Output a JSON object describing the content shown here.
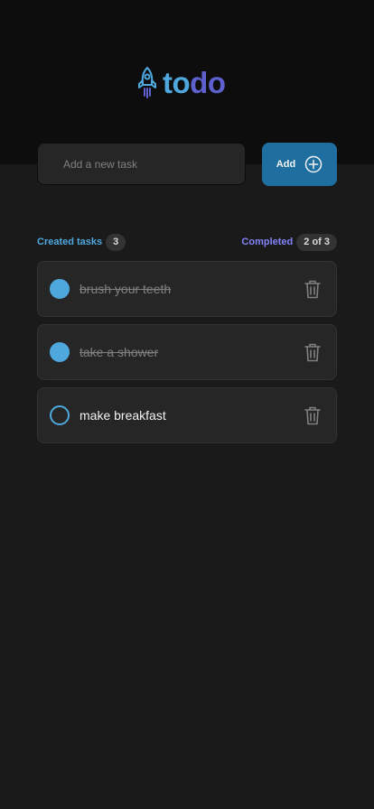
{
  "app": {
    "logo_icon": "rocket-icon",
    "logo_to": "to",
    "logo_do": "do"
  },
  "new_task": {
    "placeholder": "Add a new task",
    "value": "",
    "add_label": "Add",
    "add_icon": "plus-circle-icon"
  },
  "summary": {
    "created_label": "Created tasks",
    "created_count": "3",
    "completed_label": "Completed",
    "completed_count": "2 of 3"
  },
  "tasks": [
    {
      "label": "brush your teeth",
      "completed": true,
      "delete_icon": "trash-icon"
    },
    {
      "label": "take a shower",
      "completed": true,
      "delete_icon": "trash-icon"
    },
    {
      "label": "make breakfast",
      "completed": false,
      "delete_icon": "trash-icon"
    }
  ],
  "colors": {
    "header_bg": "#0d0d0d",
    "page_bg": "#1a1a1a",
    "blue": "#4ea8de",
    "blue_dark": "#1e6f9f",
    "purple": "#5e60ce",
    "purple_light": "#8284fa",
    "card_bg": "#262626"
  }
}
